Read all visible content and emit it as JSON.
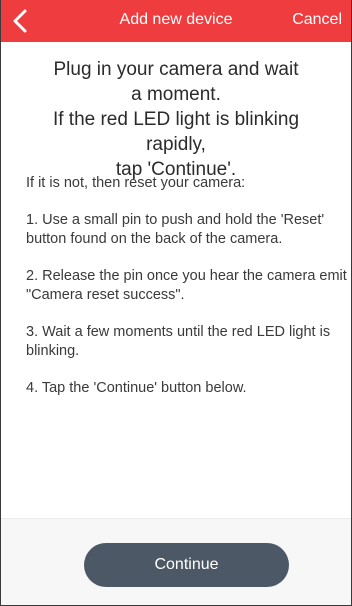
{
  "header": {
    "title": "Add new device",
    "cancel_label": "Cancel",
    "back_icon": "chevron-left-icon",
    "background_color": "#ef3c3f"
  },
  "intro": {
    "lines": [
      "Plug in your camera and wait",
      "a moment.",
      "If the red LED light is blinking rapidly,",
      "tap 'Continue'."
    ]
  },
  "instructions": {
    "lead": "If it is not, then reset your camera:",
    "steps": [
      "1. Use a small pin to push and hold the 'Reset' button found on the back of the camera.",
      "2. Release the pin once you hear the camera emit \"Camera reset success\".",
      "3. Wait a few moments until the red LED light is blinking.",
      "4. Tap the 'Continue' button below."
    ]
  },
  "footer": {
    "continue_label": "Continue",
    "button_color": "#4d5866"
  }
}
